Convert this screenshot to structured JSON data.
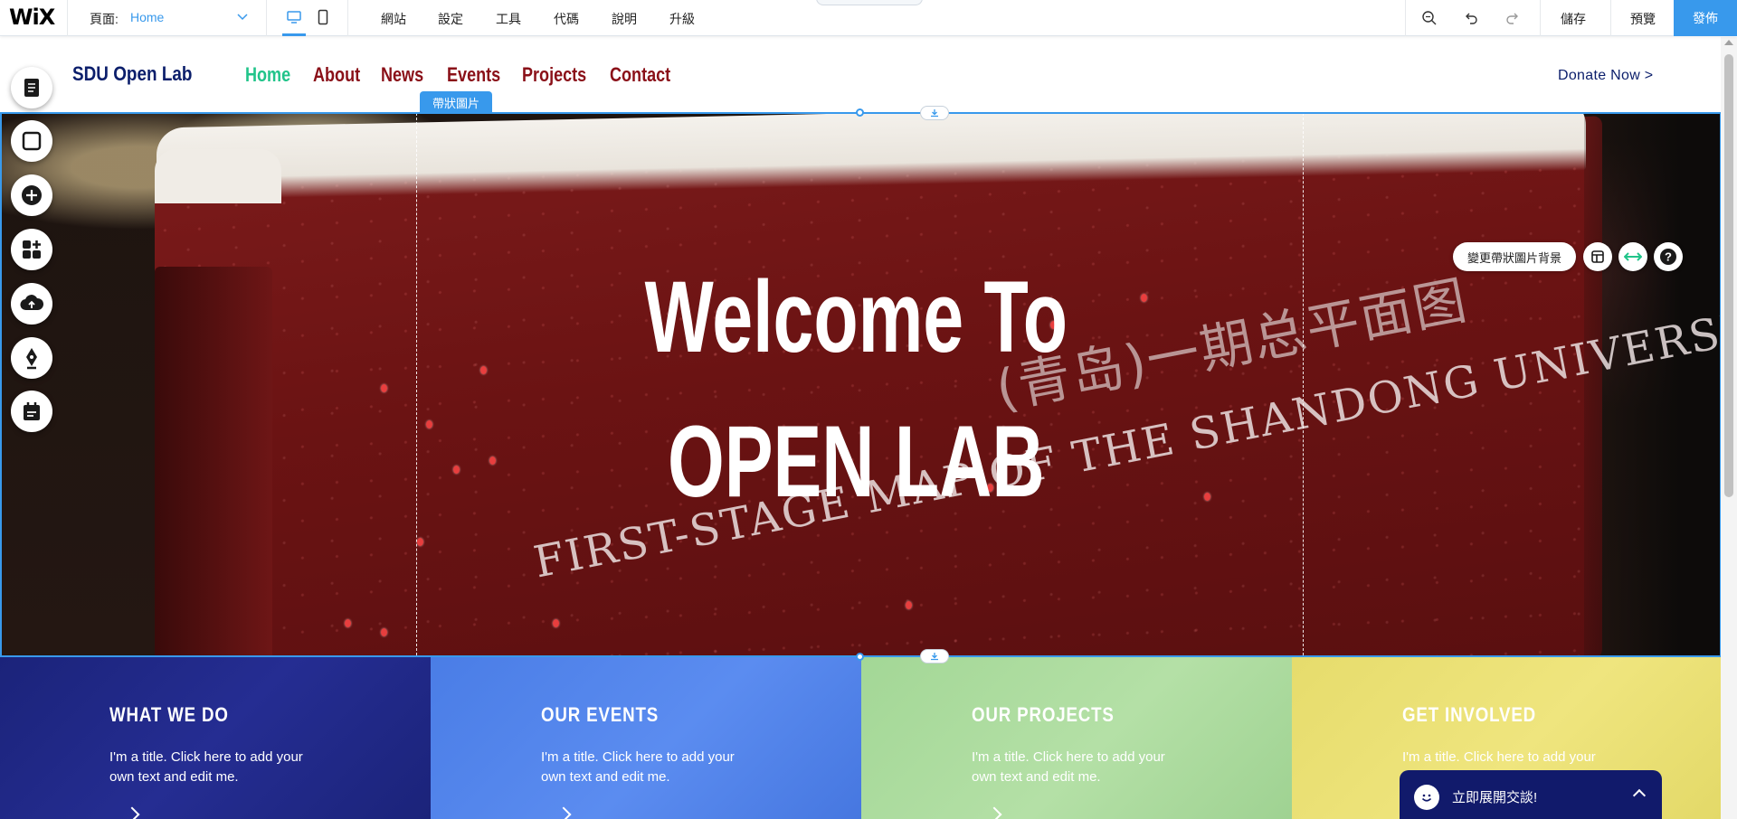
{
  "editor": {
    "logo": "WiX",
    "page_label": "頁面:",
    "page_value": "Home",
    "menu": [
      "網站",
      "設定",
      "工具",
      "代碼",
      "說明",
      "升級"
    ],
    "save": "儲存",
    "preview": "預覽",
    "publish": "發佈"
  },
  "site": {
    "logo": "SDU Open Lab",
    "nav": [
      {
        "label": "Home",
        "active": true
      },
      {
        "label": "About",
        "active": false
      },
      {
        "label": "News",
        "active": false
      },
      {
        "label": "Events",
        "active": false
      },
      {
        "label": "Projects",
        "active": false
      },
      {
        "label": "Contact",
        "active": false
      }
    ],
    "donate": "Donate Now >"
  },
  "strip": {
    "tag": "帶狀圖片",
    "change_bg": "變更帶狀圖片背景",
    "hero_line1": "Welcome To",
    "hero_line2": "OPEN LAB",
    "board_text": "FIRST-STAGE MAP OF THE SHANDONG UNIVERSITY, (QINGDAO)",
    "board_chinese": "(青岛)一期总平面图"
  },
  "columns": [
    {
      "title": "WHAT WE DO",
      "text": "I'm a title. Click here to add your own text and edit me.",
      "color": "#1e2580"
    },
    {
      "title": "OUR EVENTS",
      "text": "I'm a title. Click here to add your own text and edit me.",
      "color": "#4a7de6"
    },
    {
      "title": "OUR PROJECTS",
      "text": "I'm a title. Click here to add your own text and edit me.",
      "color": "#a6d89a"
    },
    {
      "title": "GET INVOLVED",
      "text": "I'm a title. Click here to add your own text and edit me.",
      "color": "#e8df73"
    }
  ],
  "chat": {
    "label": "立即展開交談!"
  },
  "colors": {
    "accent": "#3899ec",
    "nav": "#8a1018",
    "nav_active": "#21c48a",
    "logo": "#0b1e6b"
  }
}
